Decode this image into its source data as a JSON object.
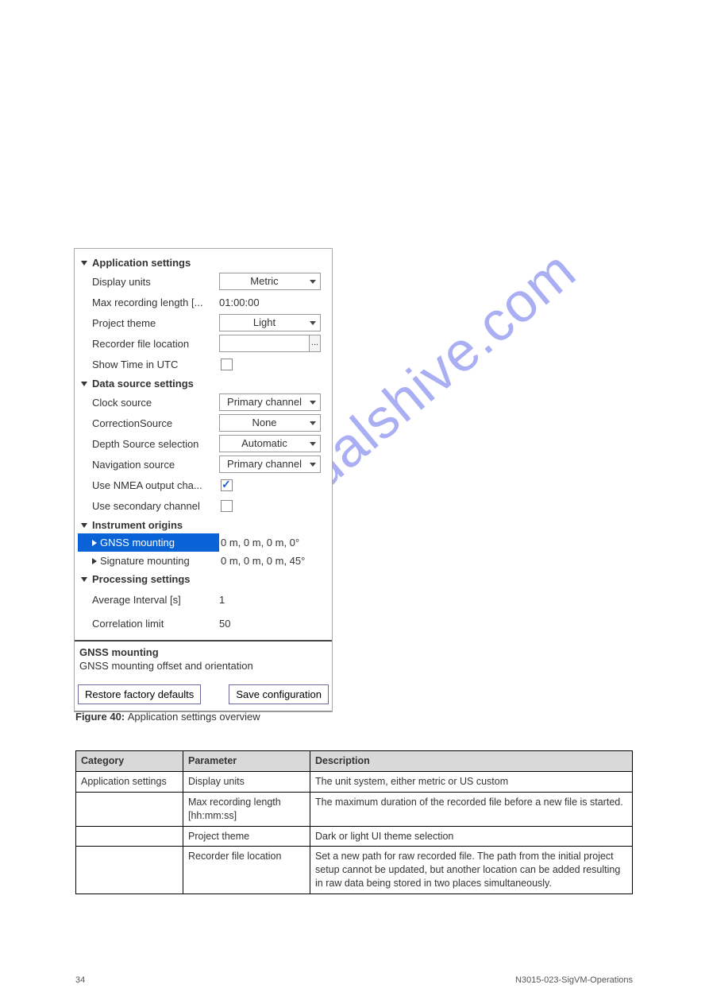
{
  "watermark": "manualshive.com",
  "panel": {
    "app_settings": {
      "header": "Application settings",
      "display_units_label": "Display units",
      "display_units_value": "Metric",
      "max_recording_label": "Max recording length [...",
      "max_recording_value": "01:00:00",
      "project_theme_label": "Project theme",
      "project_theme_value": "Light",
      "recorder_file_label": "Recorder file location",
      "recorder_file_browse": "...",
      "show_utc_label": "Show Time in UTC"
    },
    "data_source": {
      "header": "Data source settings",
      "clock_source_label": "Clock source",
      "clock_source_value": "Primary channel",
      "correction_source_label": "CorrectionSource",
      "correction_source_value": "None",
      "depth_source_label": "Depth Source selection",
      "depth_source_value": "Automatic",
      "nav_source_label": "Navigation source",
      "nav_source_value": "Primary channel",
      "use_nmea_label": "Use NMEA output cha...",
      "use_secondary_label": "Use secondary channel"
    },
    "instrument_origins": {
      "header": "Instrument origins",
      "gnss_label": "GNSS mounting",
      "gnss_value": "0 m, 0 m, 0 m, 0°",
      "sig_label": "Signature mounting",
      "sig_value": "0 m, 0 m, 0 m, 45°"
    },
    "processing": {
      "header": "Processing settings",
      "avg_interval_label": "Average Interval [s]",
      "avg_interval_value": "1",
      "corr_limit_label": "Correlation limit",
      "corr_limit_value": "50"
    },
    "help": {
      "title": "GNSS mounting",
      "desc": "GNSS mounting offset and orientation"
    },
    "footer": {
      "restore": "Restore factory defaults",
      "save": "Save configuration"
    }
  },
  "caption": {
    "bold": "Figure 40: ",
    "text": "Application settings overview"
  },
  "table": {
    "headers": [
      "Category",
      "Parameter",
      "Description"
    ],
    "rows": [
      [
        "Application settings",
        "Display units",
        "The unit system, either metric or US custom"
      ],
      [
        "",
        "Max recording length [hh:mm:ss]",
        "The maximum duration of the recorded file before a new file is started."
      ],
      [
        "",
        "Project theme",
        "Dark or light UI theme selection"
      ],
      [
        "",
        "Recorder file location",
        "Set a new path for raw recorded file. The path from the initial project setup cannot be updated, but another location can be added resulting in raw data being stored in two places simultaneously."
      ]
    ]
  },
  "footer": {
    "left": "34",
    "right": "N3015-023-SigVM-Operations"
  }
}
